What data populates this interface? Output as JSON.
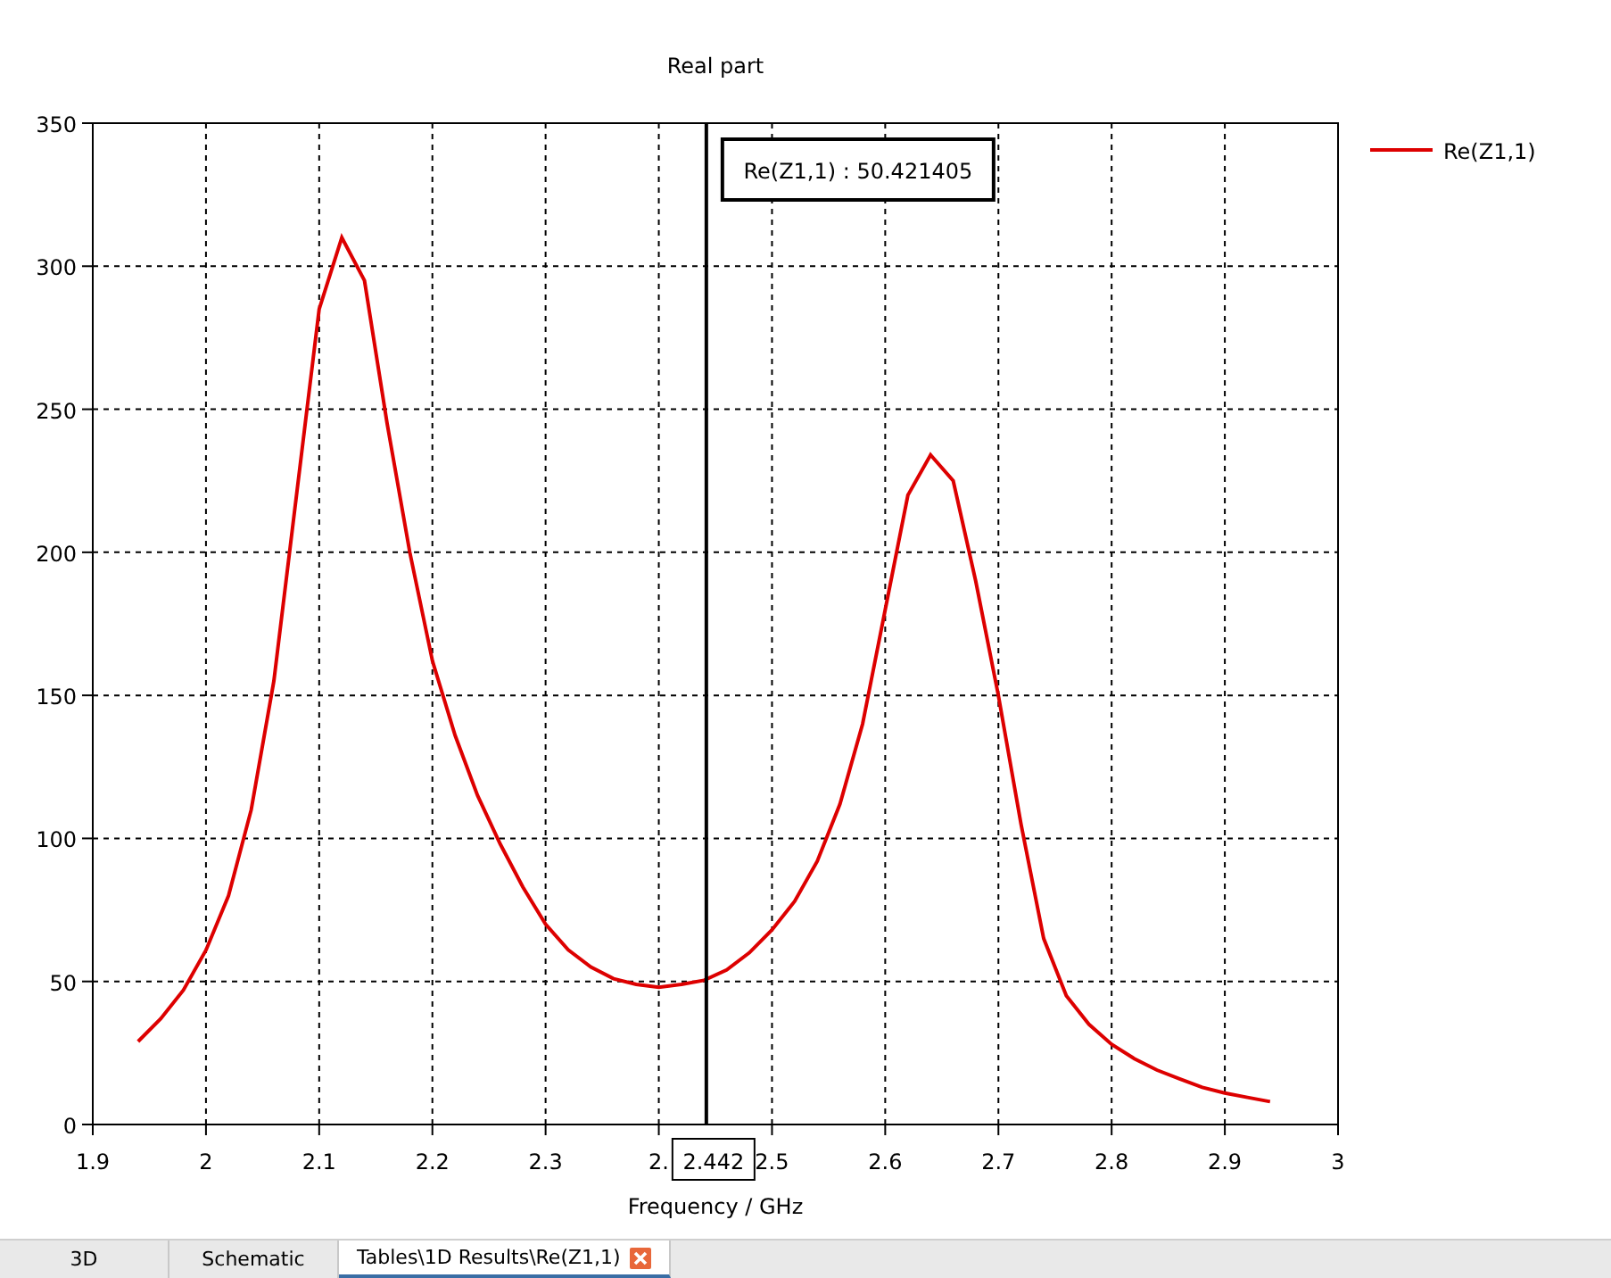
{
  "chart": {
    "chart_data": {
      "type": "line",
      "title": "Real part",
      "xlabel": "Frequency / GHz",
      "x": [
        1.94,
        1.96,
        1.98,
        2.0,
        2.02,
        2.04,
        2.06,
        2.08,
        2.1,
        2.12,
        2.14,
        2.16,
        2.18,
        2.2,
        2.22,
        2.24,
        2.26,
        2.28,
        2.3,
        2.32,
        2.34,
        2.36,
        2.38,
        2.4,
        2.42,
        2.44,
        2.46,
        2.48,
        2.5,
        2.52,
        2.54,
        2.56,
        2.58,
        2.6,
        2.62,
        2.64,
        2.66,
        2.68,
        2.7,
        2.72,
        2.74,
        2.76,
        2.78,
        2.8,
        2.82,
        2.84,
        2.86,
        2.88,
        2.9,
        2.92,
        2.94
      ],
      "series": [
        {
          "name": "Re(Z1,1)",
          "color": "#dd0000",
          "values": [
            29,
            37,
            47,
            61,
            80,
            110,
            155,
            220,
            285,
            310,
            295,
            245,
            200,
            162,
            136,
            115,
            98,
            83,
            70,
            61,
            55,
            51,
            49,
            48,
            49,
            50.4,
            54,
            60,
            68,
            78,
            92,
            112,
            140,
            180,
            220,
            234,
            225,
            190,
            150,
            105,
            65,
            45,
            35,
            28,
            23,
            19,
            16,
            13,
            11,
            9.5,
            8
          ]
        }
      ],
      "xlim": [
        1.9,
        3
      ],
      "ylim": [
        0,
        350
      ],
      "xticks": [
        1.9,
        2,
        2.1,
        2.2,
        2.3,
        {
          "value": 2.4,
          "label": "2."
        },
        2.5,
        2.6,
        2.7,
        2.8,
        2.9,
        3
      ],
      "yticks": [
        0,
        50,
        100,
        150,
        200,
        250,
        300,
        350
      ],
      "grid": true,
      "ref_lines": [
        {
          "axis": "x",
          "value": 2.442
        }
      ],
      "annotations": [
        "Re(Z1,1) : 50.421405"
      ]
    },
    "cursor_x_value": "2.442"
  },
  "tabs": [
    {
      "label": "3D",
      "selected": false,
      "closable": false
    },
    {
      "label": "Schematic",
      "selected": false,
      "closable": false
    },
    {
      "label": "Tables\\1D Results\\Re(Z1,1)",
      "selected": true,
      "closable": true
    }
  ]
}
